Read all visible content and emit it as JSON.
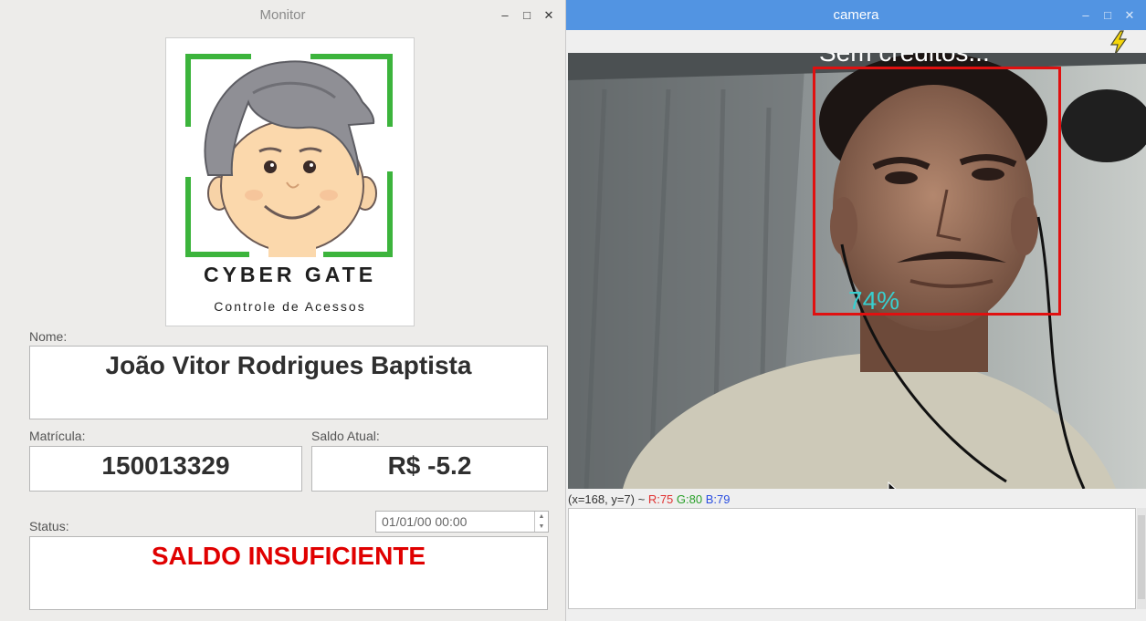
{
  "monitor": {
    "title": "Monitor",
    "logo": {
      "brand": "CYBER GATE",
      "tagline": "Controle de Acessos"
    },
    "nome": {
      "label": "Nome:",
      "value": "João Vitor Rodrigues Baptista"
    },
    "matricula": {
      "label": "Matrícula:",
      "value": "150013329"
    },
    "saldo": {
      "label": "Saldo Atual:",
      "value": "R$ -5.2"
    },
    "status": {
      "label": "Status:",
      "value": "SALDO INSUFICIENTE",
      "color": "#e00000"
    },
    "datetime": "01/01/00 00:00"
  },
  "camera": {
    "title": "camera",
    "caption": "Sem créditos...",
    "confidence": "74%",
    "box_color": "#e01010",
    "confidence_color": "#38cfcf",
    "pixel_info": {
      "coords": "(x=168, y=7) ~",
      "r": "R:75",
      "g": "G:80",
      "b": "B:79"
    }
  },
  "window_buttons": {
    "minimize": "–",
    "maximize": "□",
    "close": "✕"
  },
  "icons": [
    "flash-icon",
    "mouse-cursor-icon",
    "cyber-gate-logo"
  ]
}
